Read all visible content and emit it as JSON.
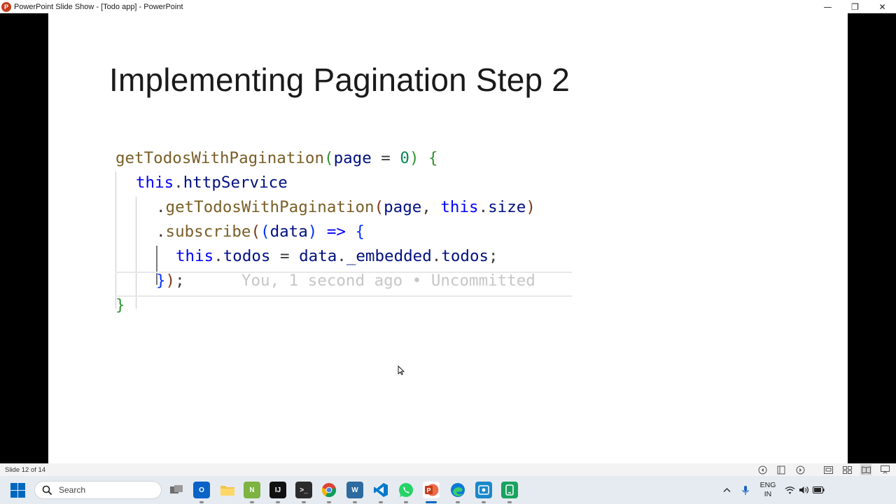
{
  "window": {
    "title": "PowerPoint Slide Show - [Todo app] - PowerPoint",
    "app_icon_letter": "P",
    "controls": {
      "minimize": "—",
      "restore": "❐",
      "close": "✕"
    }
  },
  "slide": {
    "title": "Implementing Pagination Step 2",
    "code": {
      "line1": {
        "fn": "getTodosWithPagination",
        "p1": "(",
        "arg": "page",
        "eq": " = ",
        "num": "0",
        "p2": ")",
        "sp": " ",
        "b1": "{"
      },
      "line2": {
        "kw": "this",
        "dot": ".",
        "prop": "httpService"
      },
      "line3": {
        "dot": ".",
        "fn": "getTodosWithPagination",
        "p1": "(",
        "a1": "page",
        "comma": ", ",
        "kw": "this",
        "dot2": ".",
        "prop": "size",
        "p2": ")"
      },
      "line4": {
        "dot": ".",
        "fn": "subscribe",
        "p1": "(",
        "p2": "(",
        "arg": "data",
        "p3": ")",
        "arrow": " => ",
        "b1": "{"
      },
      "line5": {
        "kw": "this",
        "dot": ".",
        "prop": "todos",
        "eq": " = ",
        "v": "data",
        "d2": ".",
        "p1": "_embedded",
        "d3": ".",
        "p2": "todos",
        "semi": ";"
      },
      "line6": {
        "b1": "}",
        "p1": ")",
        "semi": ";",
        "ghost": "You, 1 second ago • Uncommitted"
      },
      "line7": {
        "b1": "}"
      }
    }
  },
  "statusbar": {
    "slide_count": "Slide 12 of 14"
  },
  "taskbar": {
    "search_placeholder": "Search",
    "lang_top": "ENG",
    "lang_bottom": "IN"
  },
  "colors": {
    "accent": "#0067c0",
    "powerpoint": "#c43e1c"
  }
}
